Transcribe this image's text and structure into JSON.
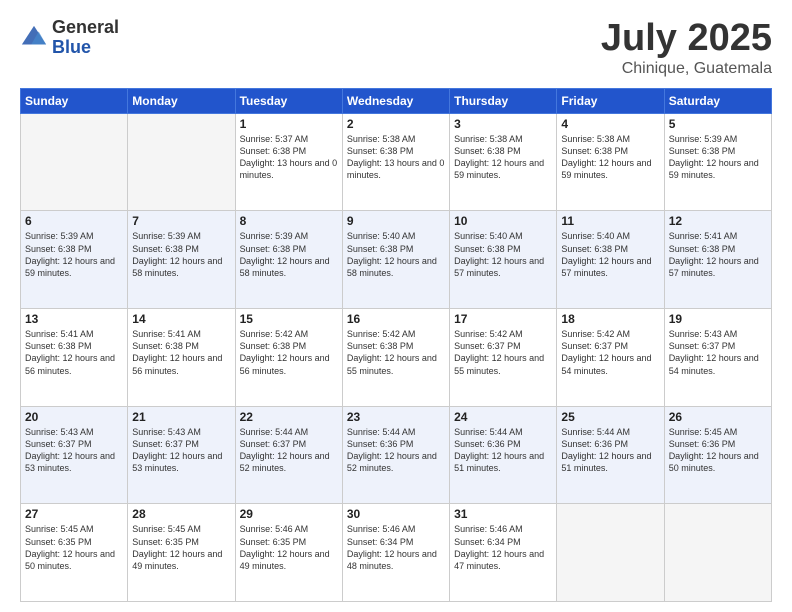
{
  "logo": {
    "general": "General",
    "blue": "Blue"
  },
  "header": {
    "title": "July 2025",
    "subtitle": "Chinique, Guatemala"
  },
  "calendar": {
    "days": [
      "Sunday",
      "Monday",
      "Tuesday",
      "Wednesday",
      "Thursday",
      "Friday",
      "Saturday"
    ],
    "weeks": [
      [
        {
          "day": "",
          "sunrise": "",
          "sunset": "",
          "daylight": ""
        },
        {
          "day": "",
          "sunrise": "",
          "sunset": "",
          "daylight": ""
        },
        {
          "day": "1",
          "sunrise": "Sunrise: 5:37 AM",
          "sunset": "Sunset: 6:38 PM",
          "daylight": "Daylight: 13 hours and 0 minutes."
        },
        {
          "day": "2",
          "sunrise": "Sunrise: 5:38 AM",
          "sunset": "Sunset: 6:38 PM",
          "daylight": "Daylight: 13 hours and 0 minutes."
        },
        {
          "day": "3",
          "sunrise": "Sunrise: 5:38 AM",
          "sunset": "Sunset: 6:38 PM",
          "daylight": "Daylight: 12 hours and 59 minutes."
        },
        {
          "day": "4",
          "sunrise": "Sunrise: 5:38 AM",
          "sunset": "Sunset: 6:38 PM",
          "daylight": "Daylight: 12 hours and 59 minutes."
        },
        {
          "day": "5",
          "sunrise": "Sunrise: 5:39 AM",
          "sunset": "Sunset: 6:38 PM",
          "daylight": "Daylight: 12 hours and 59 minutes."
        }
      ],
      [
        {
          "day": "6",
          "sunrise": "Sunrise: 5:39 AM",
          "sunset": "Sunset: 6:38 PM",
          "daylight": "Daylight: 12 hours and 59 minutes."
        },
        {
          "day": "7",
          "sunrise": "Sunrise: 5:39 AM",
          "sunset": "Sunset: 6:38 PM",
          "daylight": "Daylight: 12 hours and 58 minutes."
        },
        {
          "day": "8",
          "sunrise": "Sunrise: 5:39 AM",
          "sunset": "Sunset: 6:38 PM",
          "daylight": "Daylight: 12 hours and 58 minutes."
        },
        {
          "day": "9",
          "sunrise": "Sunrise: 5:40 AM",
          "sunset": "Sunset: 6:38 PM",
          "daylight": "Daylight: 12 hours and 58 minutes."
        },
        {
          "day": "10",
          "sunrise": "Sunrise: 5:40 AM",
          "sunset": "Sunset: 6:38 PM",
          "daylight": "Daylight: 12 hours and 57 minutes."
        },
        {
          "day": "11",
          "sunrise": "Sunrise: 5:40 AM",
          "sunset": "Sunset: 6:38 PM",
          "daylight": "Daylight: 12 hours and 57 minutes."
        },
        {
          "day": "12",
          "sunrise": "Sunrise: 5:41 AM",
          "sunset": "Sunset: 6:38 PM",
          "daylight": "Daylight: 12 hours and 57 minutes."
        }
      ],
      [
        {
          "day": "13",
          "sunrise": "Sunrise: 5:41 AM",
          "sunset": "Sunset: 6:38 PM",
          "daylight": "Daylight: 12 hours and 56 minutes."
        },
        {
          "day": "14",
          "sunrise": "Sunrise: 5:41 AM",
          "sunset": "Sunset: 6:38 PM",
          "daylight": "Daylight: 12 hours and 56 minutes."
        },
        {
          "day": "15",
          "sunrise": "Sunrise: 5:42 AM",
          "sunset": "Sunset: 6:38 PM",
          "daylight": "Daylight: 12 hours and 56 minutes."
        },
        {
          "day": "16",
          "sunrise": "Sunrise: 5:42 AM",
          "sunset": "Sunset: 6:38 PM",
          "daylight": "Daylight: 12 hours and 55 minutes."
        },
        {
          "day": "17",
          "sunrise": "Sunrise: 5:42 AM",
          "sunset": "Sunset: 6:37 PM",
          "daylight": "Daylight: 12 hours and 55 minutes."
        },
        {
          "day": "18",
          "sunrise": "Sunrise: 5:42 AM",
          "sunset": "Sunset: 6:37 PM",
          "daylight": "Daylight: 12 hours and 54 minutes."
        },
        {
          "day": "19",
          "sunrise": "Sunrise: 5:43 AM",
          "sunset": "Sunset: 6:37 PM",
          "daylight": "Daylight: 12 hours and 54 minutes."
        }
      ],
      [
        {
          "day": "20",
          "sunrise": "Sunrise: 5:43 AM",
          "sunset": "Sunset: 6:37 PM",
          "daylight": "Daylight: 12 hours and 53 minutes."
        },
        {
          "day": "21",
          "sunrise": "Sunrise: 5:43 AM",
          "sunset": "Sunset: 6:37 PM",
          "daylight": "Daylight: 12 hours and 53 minutes."
        },
        {
          "day": "22",
          "sunrise": "Sunrise: 5:44 AM",
          "sunset": "Sunset: 6:37 PM",
          "daylight": "Daylight: 12 hours and 52 minutes."
        },
        {
          "day": "23",
          "sunrise": "Sunrise: 5:44 AM",
          "sunset": "Sunset: 6:36 PM",
          "daylight": "Daylight: 12 hours and 52 minutes."
        },
        {
          "day": "24",
          "sunrise": "Sunrise: 5:44 AM",
          "sunset": "Sunset: 6:36 PM",
          "daylight": "Daylight: 12 hours and 51 minutes."
        },
        {
          "day": "25",
          "sunrise": "Sunrise: 5:44 AM",
          "sunset": "Sunset: 6:36 PM",
          "daylight": "Daylight: 12 hours and 51 minutes."
        },
        {
          "day": "26",
          "sunrise": "Sunrise: 5:45 AM",
          "sunset": "Sunset: 6:36 PM",
          "daylight": "Daylight: 12 hours and 50 minutes."
        }
      ],
      [
        {
          "day": "27",
          "sunrise": "Sunrise: 5:45 AM",
          "sunset": "Sunset: 6:35 PM",
          "daylight": "Daylight: 12 hours and 50 minutes."
        },
        {
          "day": "28",
          "sunrise": "Sunrise: 5:45 AM",
          "sunset": "Sunset: 6:35 PM",
          "daylight": "Daylight: 12 hours and 49 minutes."
        },
        {
          "day": "29",
          "sunrise": "Sunrise: 5:46 AM",
          "sunset": "Sunset: 6:35 PM",
          "daylight": "Daylight: 12 hours and 49 minutes."
        },
        {
          "day": "30",
          "sunrise": "Sunrise: 5:46 AM",
          "sunset": "Sunset: 6:34 PM",
          "daylight": "Daylight: 12 hours and 48 minutes."
        },
        {
          "day": "31",
          "sunrise": "Sunrise: 5:46 AM",
          "sunset": "Sunset: 6:34 PM",
          "daylight": "Daylight: 12 hours and 47 minutes."
        },
        {
          "day": "",
          "sunrise": "",
          "sunset": "",
          "daylight": ""
        },
        {
          "day": "",
          "sunrise": "",
          "sunset": "",
          "daylight": ""
        }
      ]
    ]
  }
}
